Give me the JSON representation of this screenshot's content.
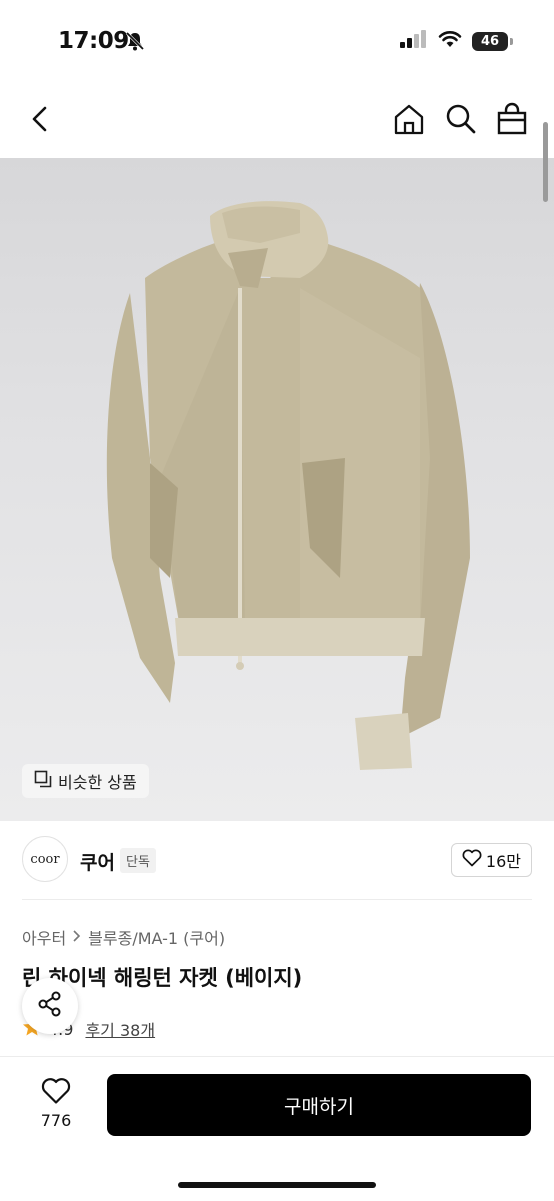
{
  "status_bar": {
    "time": "17:09",
    "battery": "46"
  },
  "hero": {
    "similar_label": "비슷한 상품"
  },
  "brand": {
    "logo_text": "coor",
    "name": "쿠어",
    "badge": "단독",
    "likes": "16만"
  },
  "product": {
    "breadcrumb": [
      "아우터",
      "블루종/MA-1 (쿠어)"
    ],
    "title": "린 하이넥 해링턴 자켓 (베이지)",
    "rating": "4.9",
    "reviews": "후기 38개"
  },
  "bottom": {
    "wish_count": "776",
    "buy_label": "구매하기"
  },
  "colors": {
    "jacket": "#c3b99c",
    "rib": "#d9d2bd",
    "buy_bg": "#000000"
  }
}
